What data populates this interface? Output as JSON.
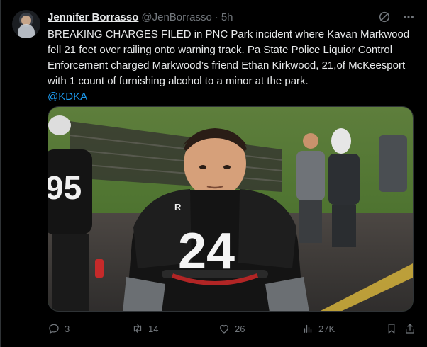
{
  "tweet": {
    "author_name": "Jennifer Borrasso",
    "author_handle": "@JenBorrasso",
    "separator": "·",
    "time": "5h",
    "body": "BREAKING CHARGES FILED in PNC Park incident where Kavan Markwood fell 21 feet over railing onto warning track. Pa State Police Liquior Control Enforcement charged Markwood’s friend Ethan Kirkwood, 21,of McKeesport with 1 count of furnishing alcohol to a minor at the park.",
    "mention": "@KDKA"
  },
  "image": {
    "jersey_front": "24",
    "jersey_back": "95",
    "shoulder_logo": "R"
  },
  "actions": {
    "replies": "3",
    "reposts": "14",
    "likes": "26",
    "views": "27K"
  },
  "colors": {
    "background": "#000000",
    "text": "#e7e9ea",
    "muted": "#71767b",
    "link": "#1d9bf0"
  }
}
